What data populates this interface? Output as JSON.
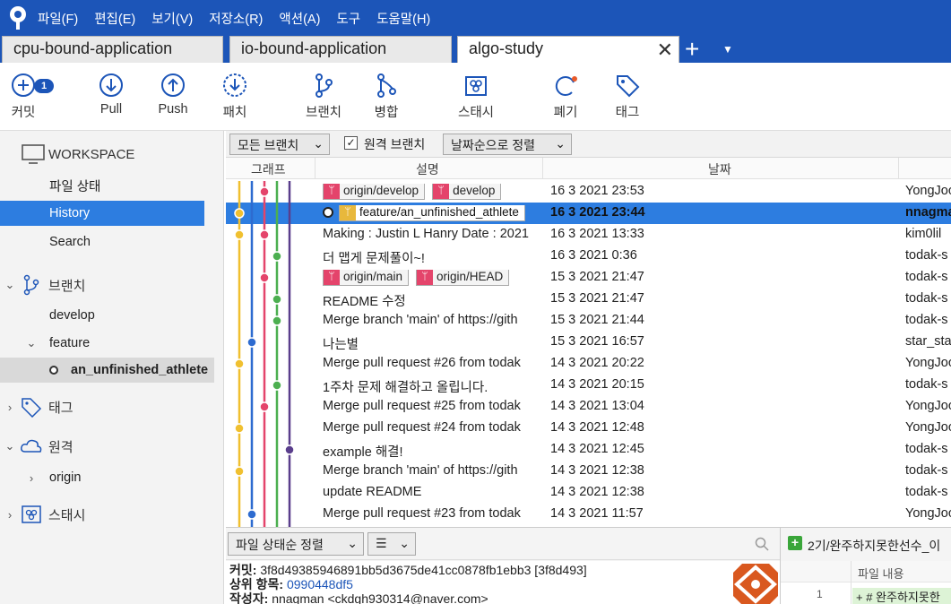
{
  "menu": [
    "파일(F)",
    "편집(E)",
    "보기(V)",
    "저장소(R)",
    "액션(A)",
    "도구",
    "도움말(H)"
  ],
  "tabs": [
    {
      "label": "cpu-bound-application"
    },
    {
      "label": "io-bound-application"
    },
    {
      "label": "algo-study"
    }
  ],
  "tab_close": "✕",
  "tab_add": "+",
  "tab_dropdown": "▼",
  "toolbar": {
    "commit_label": "커밋",
    "commit_badge": "1",
    "pull_label": "Pull",
    "push_label": "Push",
    "patch_label": "패치",
    "branch_label": "브랜치",
    "merge_label": "병합",
    "stash_label": "스태시",
    "discard_label": "폐기",
    "tag_label": "태그"
  },
  "sidebar": {
    "workspace": "WORKSPACE",
    "file_status": "파일 상태",
    "history": "History",
    "search": "Search",
    "branches": "브랜치",
    "develop": "develop",
    "feature": "feature",
    "current_branch": "an_unfinished_athlete",
    "tags": "태그",
    "remotes": "원격",
    "origin": "origin",
    "stashes": "스태시"
  },
  "filter": {
    "branches_dropdown": "모든 브랜치",
    "remote_checkbox_label": "원격 브랜치",
    "sort_dropdown": "날짜순으로 정렬",
    "checked": "✓"
  },
  "columns": {
    "graph": "그래프",
    "description": "설명",
    "date": "날짜"
  },
  "commits": [
    {
      "refs": [
        {
          "name": "origin/develop",
          "kind": "remote"
        },
        {
          "name": "develop",
          "kind": "remote"
        }
      ],
      "desc": "",
      "date": "16 3 2021 23:53",
      "author": "YongJoo"
    },
    {
      "refs": [
        {
          "name": "feature/an_unfinished_athlete",
          "kind": "branch"
        }
      ],
      "desc": "",
      "date": "16 3 2021 23:44",
      "author": "nnagman",
      "selected": true
    },
    {
      "refs": [],
      "desc": "Making : Justin L Hanry Date : 2021",
      "date": "16 3 2021 13:33",
      "author": "kim0lil"
    },
    {
      "refs": [],
      "desc": "더 맵게 문제풀이~!",
      "date": "16 3 2021 0:36",
      "author": "todak-s"
    },
    {
      "refs": [
        {
          "name": "origin/main",
          "kind": "remote"
        },
        {
          "name": "origin/HEAD",
          "kind": "remote"
        }
      ],
      "desc": "",
      "date": "15 3 2021 21:47",
      "author": "todak-s"
    },
    {
      "refs": [],
      "desc": "README 수정",
      "date": "15 3 2021 21:47",
      "author": "todak-s"
    },
    {
      "refs": [],
      "desc": "Merge branch 'main' of https://gith",
      "date": "15 3 2021 21:44",
      "author": "todak-s"
    },
    {
      "refs": [],
      "desc": "나는별",
      "date": "15 3 2021 16:57",
      "author": "star_sta"
    },
    {
      "refs": [],
      "desc": "Merge pull request #26 from todak",
      "date": "14 3 2021 20:22",
      "author": "YongJoo"
    },
    {
      "refs": [],
      "desc": "1주차 문제 해결하고 올립니다.",
      "date": "14 3 2021 20:15",
      "author": "todak-s"
    },
    {
      "refs": [],
      "desc": "Merge pull request #25 from todak",
      "date": "14 3 2021 13:04",
      "author": "YongJoo"
    },
    {
      "refs": [],
      "desc": "Merge pull request #24 from todak",
      "date": "14 3 2021 12:48",
      "author": "YongJoo"
    },
    {
      "refs": [],
      "desc": "example 해결!",
      "date": "14 3 2021 12:45",
      "author": "todak-s"
    },
    {
      "refs": [],
      "desc": "Merge branch 'main' of https://gith",
      "date": "14 3 2021 12:38",
      "author": "todak-s"
    },
    {
      "refs": [],
      "desc": "update README",
      "date": "14 3 2021 12:38",
      "author": "todak-s"
    },
    {
      "refs": [],
      "desc": "Merge pull request #23 from todak",
      "date": "14 3 2021 11:57",
      "author": "YongJoo"
    }
  ],
  "bottom": {
    "sort_dropdown": "파일 상태순 정렬",
    "view_dropdown": "☰",
    "commit_key": "커밋:",
    "commit_value": "3f8d49385946891bb5d3675de41cc0878fb1ebb3 [3f8d493]",
    "parent_key": "상위 항목:",
    "parent_value": "0990448df5",
    "author_key": "작성자:",
    "author_value": "nnagman <ckdgh930314@naver.com>",
    "diff_file": "2기/완주하지못한선수_이",
    "diff_column": "파일 내용",
    "diff_line_no": "1",
    "diff_line": "+ # 완주하지못한"
  },
  "colors": {
    "accent": "#1c55b8",
    "selection": "#2d7de0",
    "ref_remote": "#e4446b",
    "ref_branch": "#e8b83c"
  }
}
